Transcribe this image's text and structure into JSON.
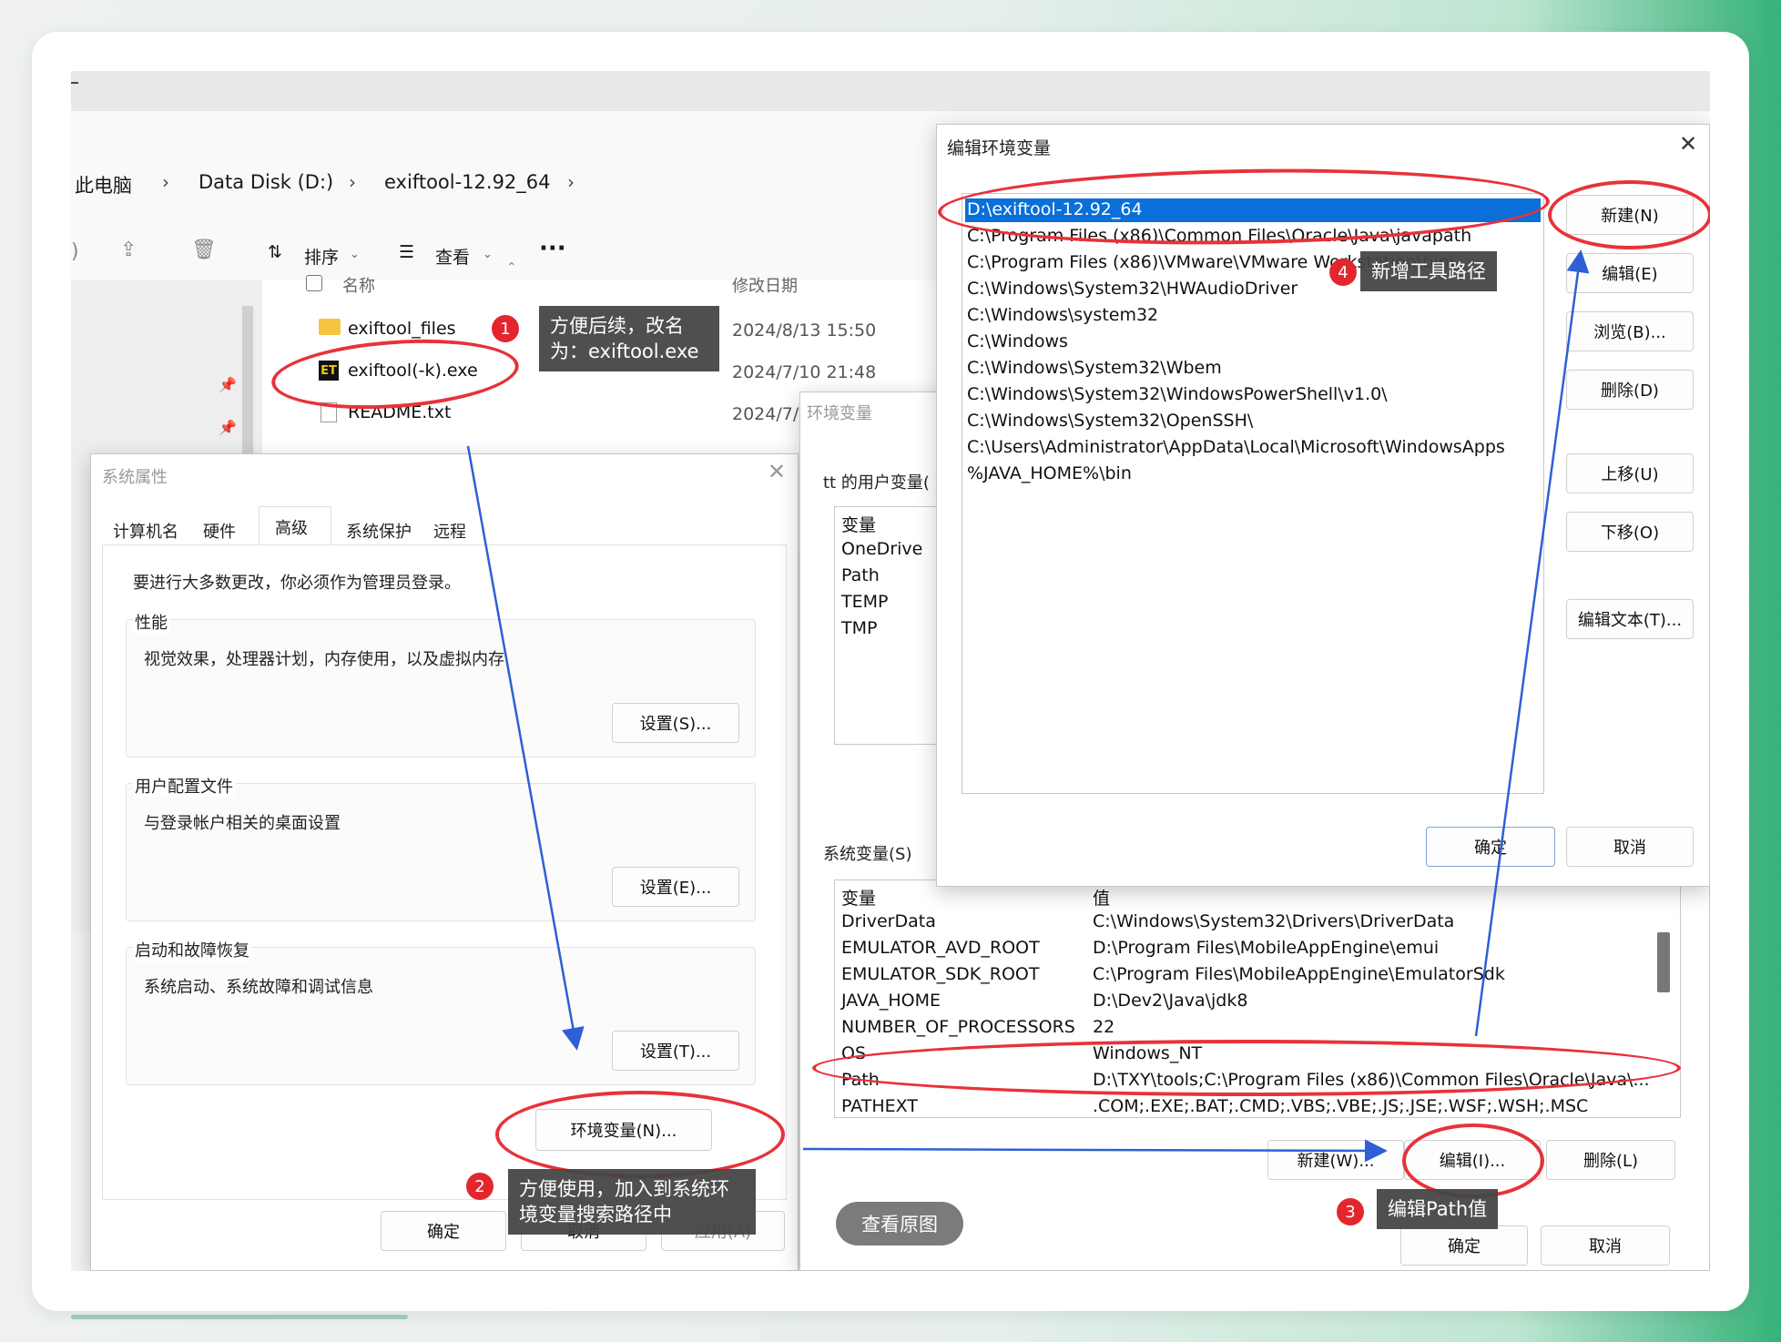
{
  "explorer": {
    "breadcrumb": [
      "此电脑",
      "Data Disk (D:)",
      "exiftool-12.92_64"
    ],
    "toolbar": {
      "sort": "排序",
      "view": "查看",
      "more": "···"
    },
    "columns": {
      "name": "名称",
      "date": "修改日期"
    },
    "files": [
      {
        "name": "exiftool_files",
        "date": "2024/8/13 15:50",
        "icon": "folder-icon"
      },
      {
        "name": "exiftool(-k).exe",
        "date": "2024/7/10 21:48",
        "icon": "exe-icon"
      },
      {
        "name": "README.txt",
        "date": "2024/7/",
        "icon": "text-file-icon"
      }
    ]
  },
  "sysprops": {
    "title": "系统属性",
    "tabs": [
      "计算机名",
      "硬件",
      "高级",
      "系统保护",
      "远程"
    ],
    "notice": "要进行大多数更改，你必须作为管理员登录。",
    "perf": {
      "label": "性能",
      "desc": "视觉效果，处理器计划，内存使用，以及虚拟内存",
      "button": "设置(S)..."
    },
    "profile": {
      "label": "用户配置文件",
      "desc": "与登录帐户相关的桌面设置",
      "button": "设置(E)..."
    },
    "startup": {
      "label": "启动和故障恢复",
      "desc": "系统启动、系统故障和调试信息",
      "button": "设置(T)..."
    },
    "env_button": "环境变量(N)...",
    "ok": "确定",
    "cancel": "取消",
    "apply": "应用(A)"
  },
  "envvars": {
    "title": "环境变量",
    "user_label": "tt 的用户变量(",
    "user_header": "变量",
    "user_vars": [
      "OneDrive",
      "Path",
      "TEMP",
      "TMP"
    ],
    "sys_label": "系统变量(S)",
    "sys_header": {
      "var": "变量",
      "val": "值"
    },
    "sys_vars": [
      {
        "name": "DriverData",
        "value": "C:\\Windows\\System32\\Drivers\\DriverData"
      },
      {
        "name": "EMULATOR_AVD_ROOT",
        "value": "D:\\Program Files\\MobileAppEngine\\emui"
      },
      {
        "name": "EMULATOR_SDK_ROOT",
        "value": "C:\\Program Files\\MobileAppEngine\\EmulatorSdk"
      },
      {
        "name": "JAVA_HOME",
        "value": "D:\\Dev2\\Java\\jdk8"
      },
      {
        "name": "NUMBER_OF_PROCESSORS",
        "value": "22"
      },
      {
        "name": "OS",
        "value": "Windows_NT"
      },
      {
        "name": "Path",
        "value": "D:\\TXY\\tools;C:\\Program Files (x86)\\Common Files\\Oracle\\Java\\..."
      },
      {
        "name": "PATHEXT",
        "value": ".COM;.EXE;.BAT;.CMD;.VBS;.VBE;.JS;.JSE;.WSF;.WSH;.MSC"
      }
    ],
    "new": "新建(W)...",
    "edit": "编辑(I)...",
    "delete": "删除(L)",
    "ok": "确定",
    "cancel": "取消"
  },
  "editenv": {
    "title": "编辑环境变量",
    "paths": [
      "D:\\exiftool-12.92_64",
      "C:\\Program Files (x86)\\Common Files\\Oracle\\Java\\javapath",
      "C:\\Program Files (x86)\\VMware\\VMware Workstation\\bin\\",
      "C:\\Windows\\System32\\HWAudioDriver",
      "C:\\Windows\\system32",
      "C:\\Windows",
      "C:\\Windows\\System32\\Wbem",
      "C:\\Windows\\System32\\WindowsPowerShell\\v1.0\\",
      "C:\\Windows\\System32\\OpenSSH\\",
      "C:\\Users\\Administrator\\AppData\\Local\\Microsoft\\WindowsApps",
      "%JAVA_HOME%\\bin"
    ],
    "buttons": {
      "new": "新建(N)",
      "edit": "编辑(E)",
      "browse": "浏览(B)...",
      "delete": "删除(D)",
      "up": "上移(U)",
      "down": "下移(O)",
      "edit_text": "编辑文本(T)..."
    },
    "ok": "确定",
    "cancel": "取消"
  },
  "annotations": [
    {
      "n": "1",
      "text": "方便后续，改名为：exiftool.exe"
    },
    {
      "n": "2",
      "text": "方便使用，加入到系统环境变量搜索路径中"
    },
    {
      "n": "3",
      "text": "编辑Path值"
    },
    {
      "n": "4",
      "text": "新增工具路径"
    }
  ],
  "view_original": "查看原图",
  "colors": {
    "annotation_red": "#e3262e",
    "arrow_blue": "#2f5fd6",
    "selection_blue": "#0a6fd8"
  }
}
